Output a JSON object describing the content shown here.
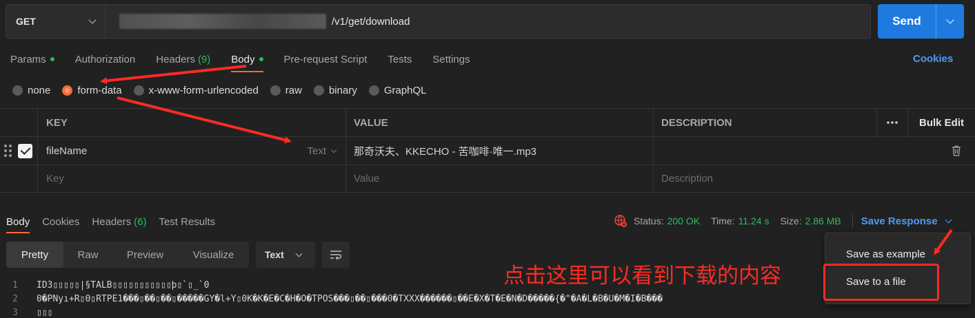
{
  "request": {
    "method": "GET",
    "url_suffix": "/v1/get/download",
    "send_label": "Send"
  },
  "request_tabs": [
    {
      "label": "Params",
      "dot": true
    },
    {
      "label": "Authorization"
    },
    {
      "label": "Headers",
      "count": "(9)"
    },
    {
      "label": "Body",
      "dot": true,
      "active": true
    },
    {
      "label": "Pre-request Script"
    },
    {
      "label": "Tests"
    },
    {
      "label": "Settings"
    }
  ],
  "cookies_link": "Cookies",
  "body_types": [
    {
      "label": "none"
    },
    {
      "label": "form-data",
      "selected": true
    },
    {
      "label": "x-www-form-urlencoded"
    },
    {
      "label": "raw"
    },
    {
      "label": "binary"
    },
    {
      "label": "GraphQL"
    }
  ],
  "params_table": {
    "headers": {
      "key": "KEY",
      "value": "VALUE",
      "description": "DESCRIPTION",
      "bulk_edit": "Bulk Edit"
    },
    "row": {
      "key": "fileName",
      "type": "Text",
      "value": "那奇沃夫、KKECHO - 苦咖啡·唯一.mp3",
      "description": ""
    },
    "placeholders": {
      "key": "Key",
      "value": "Value",
      "description": "Description"
    }
  },
  "response_tabs": [
    {
      "label": "Body",
      "active": true
    },
    {
      "label": "Cookies"
    },
    {
      "label": "Headers",
      "count": "(6)"
    },
    {
      "label": "Test Results"
    }
  ],
  "status": {
    "status_label": "Status:",
    "status_value": "200 OK",
    "time_label": "Time:",
    "time_value": "11.24 s",
    "size_label": "Size:",
    "size_value": "2.86 MB",
    "save_response": "Save Response"
  },
  "view_tabs": [
    "Pretty",
    "Raw",
    "Preview",
    "Visualize"
  ],
  "format": "Text",
  "code_lines": [
    {
      "n": "1",
      "text": "ID3▯▯▯▯▯|§TALB▯▯▯▯▯▯▯▯▯▯▯þ▯`▯_`0"
    },
    {
      "n": "2",
      "text": "0�PNyı+R▯0▯RTPE1���▯��▯��▯�����GY�l+Y▯0K�K�E�C�H�O�TPOS���▯��▯���0�TXXX������▯��E�X�T�E�N�D�����{�\"�A�L�B�U�M�I�B���"
    },
    {
      "n": "3",
      "text": "▯▯▯"
    }
  ],
  "save_menu": {
    "items": [
      "Save as example",
      "Save to a file"
    ]
  },
  "annotation": "点击这里可以看到下载的内容",
  "colors": {
    "accent": "#ff6c37",
    "link": "#4c9cf5",
    "send": "#1f7ae0",
    "ok": "#2ebd59",
    "annotation": "#ff2b23"
  },
  "icons": [
    "chevron-down-icon",
    "checkbox-icon",
    "drag-handle-icon",
    "trash-icon",
    "more-icon",
    "globe-error-icon",
    "wrap-lines-icon"
  ]
}
